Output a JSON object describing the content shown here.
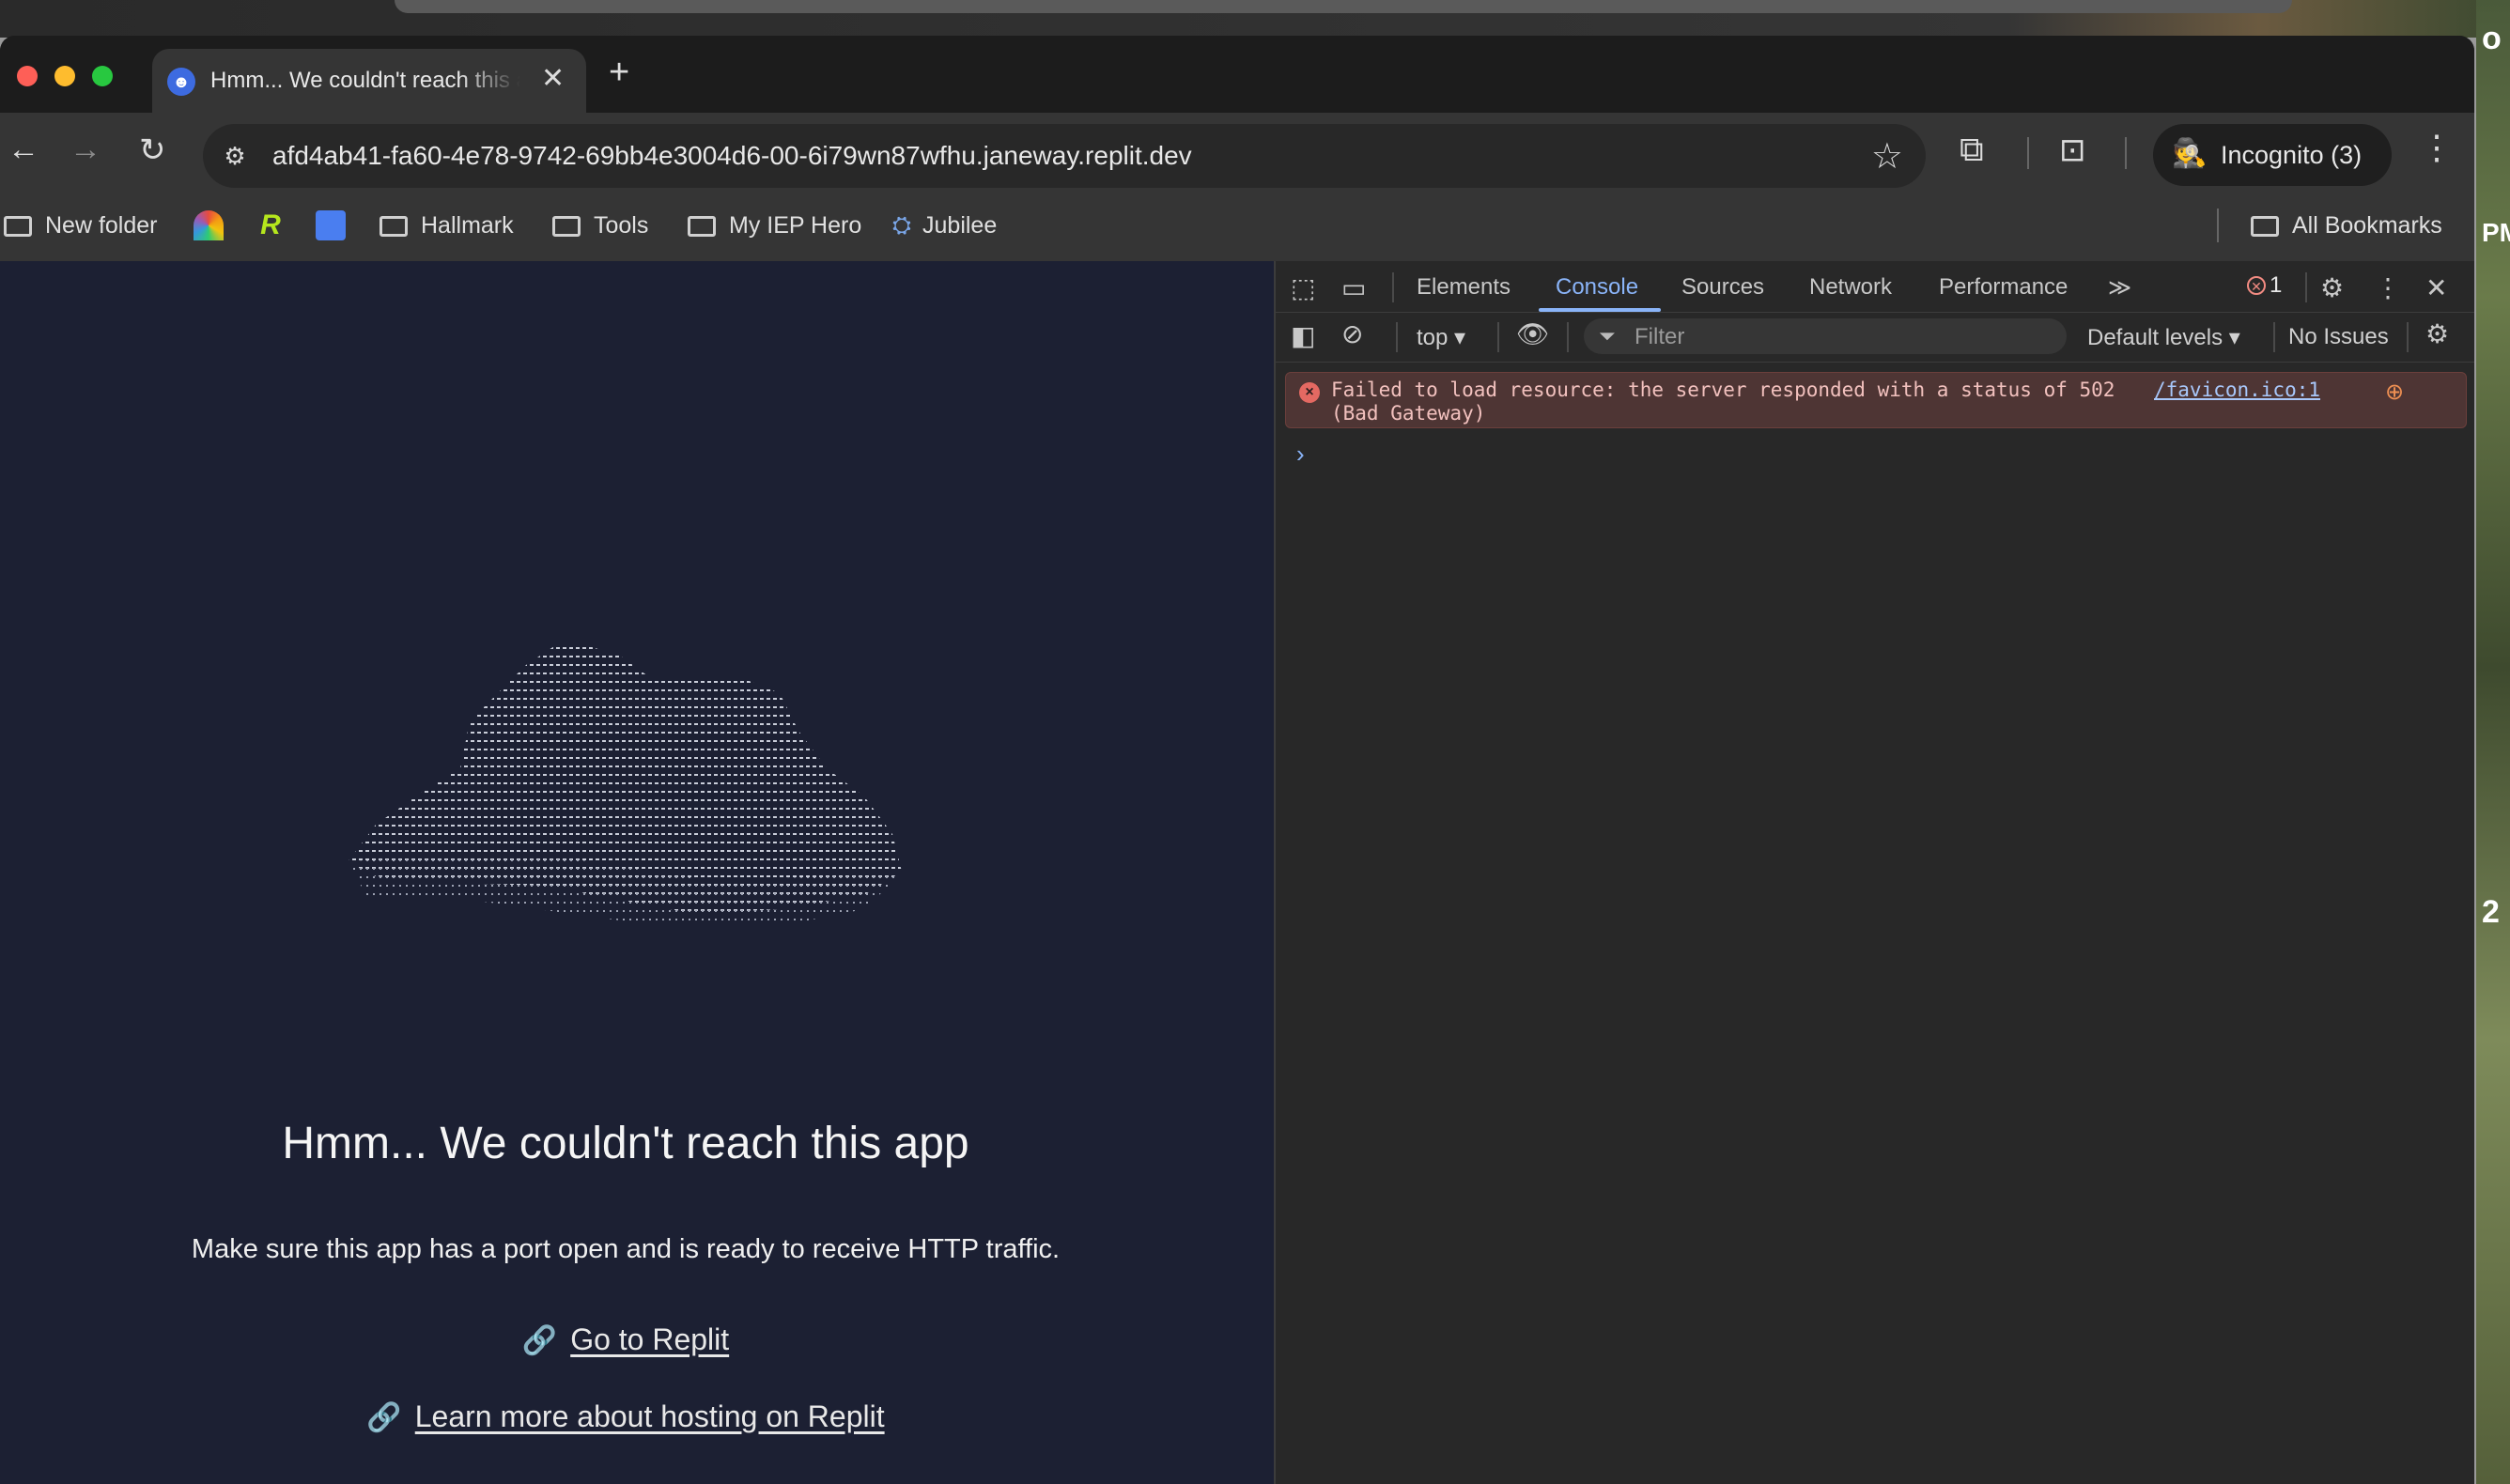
{
  "browser": {
    "tab": {
      "title": "Hmm... We couldn't reach this app",
      "favicon": "replit-person-icon"
    },
    "new_tab_label": "+",
    "url": "afd4ab41-fa60-4e78-9742-69bb4e3004d6-00-6i79wn87wfhu.janeway.replit.dev",
    "incognito_label": "Incognito (3)",
    "bookmarks": [
      {
        "label": "New folder",
        "type": "folder"
      },
      {
        "label": "",
        "type": "site",
        "icon": "rainbow-icon"
      },
      {
        "label": "",
        "type": "site",
        "icon": "r-logo-icon"
      },
      {
        "label": "",
        "type": "site",
        "icon": "docs-icon"
      },
      {
        "label": "Hallmark",
        "type": "folder"
      },
      {
        "label": "Tools",
        "type": "folder"
      },
      {
        "label": "My IEP Hero",
        "type": "folder"
      },
      {
        "label": "Jubilee",
        "type": "site",
        "icon": "jubilee-icon"
      }
    ],
    "all_bookmarks_label": "All Bookmarks"
  },
  "page": {
    "heading": "Hmm... We couldn't reach this app",
    "subtext": "Make sure this app has a port open and is ready to receive HTTP traffic.",
    "links": [
      {
        "label": "Go to Replit",
        "icon": "link-icon"
      },
      {
        "label": "Learn more about hosting on Replit",
        "icon": "link-icon"
      }
    ]
  },
  "devtools": {
    "tabs": [
      "Elements",
      "Console",
      "Sources",
      "Network",
      "Performance"
    ],
    "active_tab": "Console",
    "more_tabs_label": "≫",
    "error_count": "1",
    "context": "top",
    "filter_placeholder": "Filter",
    "levels_label": "Default levels",
    "issues_label": "No Issues",
    "console": {
      "error_message": "Failed to load resource: the server responded with a status of 502\n(Bad Gateway)",
      "error_source": "/favicon.ico:1",
      "prompt": "›"
    }
  },
  "desktop": {
    "right_fragments": [
      "o",
      "PM",
      "2"
    ]
  }
}
